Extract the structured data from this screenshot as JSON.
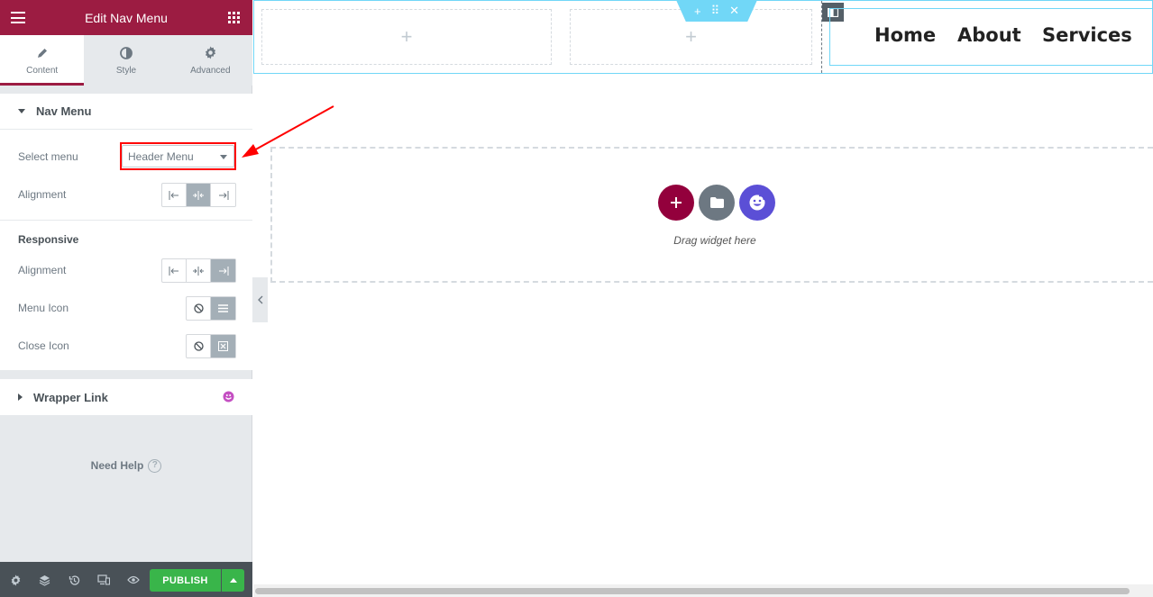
{
  "panel": {
    "title": "Edit Nav Menu",
    "tabs": [
      {
        "label": "Content",
        "icon": "pencil-icon",
        "active": true
      },
      {
        "label": "Style",
        "icon": "half-circle-icon",
        "active": false
      },
      {
        "label": "Advanced",
        "icon": "gear-icon",
        "active": false
      }
    ],
    "nav_menu_section": {
      "title": "Nav Menu",
      "select_menu_label": "Select menu",
      "select_menu_value": "Header Menu",
      "alignment_label": "Alignment",
      "responsive_heading": "Responsive",
      "responsive_alignment_label": "Alignment",
      "menu_icon_label": "Menu Icon",
      "close_icon_label": "Close Icon"
    },
    "wrapper_link_section": {
      "title": "Wrapper Link"
    },
    "help": {
      "label": "Need Help",
      "icon_glyph": "?"
    },
    "footer": {
      "publish_label": "PUBLISH"
    }
  },
  "canvas": {
    "empty_column_glyph": "+",
    "section_handle": {
      "add": "+",
      "move": "⠿",
      "close": "✕"
    },
    "nav_items": [
      "Home",
      "About",
      "Services"
    ],
    "drop_zone": {
      "text": "Drag widget here"
    }
  },
  "colors": {
    "accent": "#9c1c42",
    "publish": "#39b54a",
    "section_outline": "#71d7f7",
    "highlight": "#ff0000",
    "ai_button": "#5b4fd6"
  }
}
